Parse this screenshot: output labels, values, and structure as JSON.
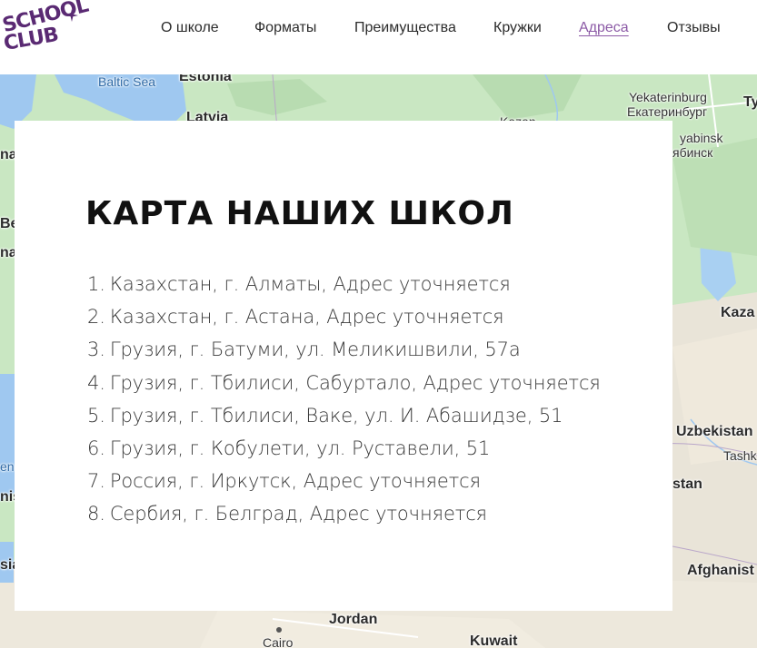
{
  "logo": {
    "line1": "SCHOOL",
    "line2": "CLUB"
  },
  "nav": [
    {
      "label": "О школе",
      "active": false
    },
    {
      "label": "Форматы",
      "active": false
    },
    {
      "label": "Преимущества",
      "active": false
    },
    {
      "label": "Кружки",
      "active": false
    },
    {
      "label": "Адреса",
      "active": true
    },
    {
      "label": "Отзывы",
      "active": false
    }
  ],
  "colors": {
    "brand": "#5a2a73",
    "nav_active": "#8c5aa6",
    "map_land": "#c9e7c2",
    "map_water": "#9fc8f0"
  },
  "map": {
    "labels": [
      "Baltic Sea",
      "Estonia",
      "Latvia",
      "Yekaterinburg",
      "Екатеринбург",
      "yabinsk",
      "ябинск",
      "Kaza",
      "Uzbekistan",
      "Tashk",
      "stan",
      "Afghanist",
      "Jordan",
      "Cairo",
      "Kuwait",
      "Kazan",
      "na",
      "Be",
      "na",
      "en",
      "nis",
      "sia",
      "Ty"
    ]
  },
  "card": {
    "title": "КАРТА НАШИХ ШКОЛ",
    "addresses": [
      {
        "num": "1.",
        "text": "Казахстан, г. Алматы, Адрес уточняется"
      },
      {
        "num": "2.",
        "text": "Казахстан, г. Астана, Адрес уточняется"
      },
      {
        "num": "3.",
        "text": "Грузия, г. Батуми, ул. Меликишвили, 57а"
      },
      {
        "num": "4.",
        "text": "Грузия, г. Тбилиси, Сабуртало, Адрес уточняется"
      },
      {
        "num": "5.",
        "text": "Грузия, г. Тбилиси, Ваке, ул. И. Абашидзе, 51"
      },
      {
        "num": "6.",
        "text": "Грузия, г. Кобулети, ул. Руставели, 51"
      },
      {
        "num": "7.",
        "text": "Россия, г. Иркутск, Адрес уточняется"
      },
      {
        "num": "8.",
        "text": "Сербия, г. Белград, Адрес уточняется"
      }
    ]
  }
}
